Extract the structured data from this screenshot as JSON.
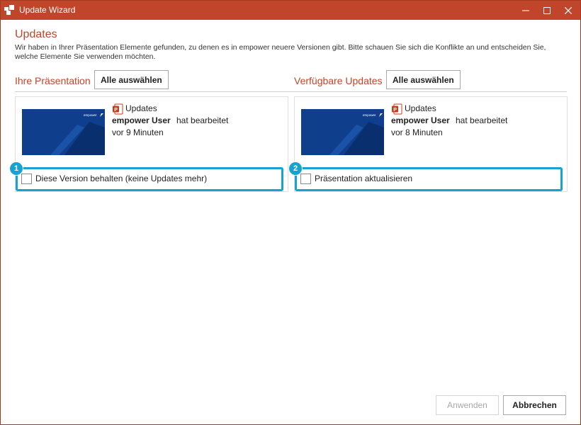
{
  "window": {
    "title": "Update Wizard"
  },
  "header": {
    "title": "Updates",
    "description": "Wir haben in Ihrer Präsentation Elemente gefunden, zu denen es in empower neuere Versionen gibt. Bitte schauen Sie sich die Konflikte an und entscheiden Sie, welche Elemente Sie verwenden möchten."
  },
  "left": {
    "label": "Ihre Präsentation",
    "select_all": "Alle auswählen",
    "card": {
      "doc_name": "Updates",
      "user": "empower User",
      "action": "hat bearbeitet",
      "time": "vor 9 Minuten",
      "thumb_brand": "empower",
      "option_badge": "1",
      "option_label": "Diese Version behalten (keine Updates mehr)",
      "option_checked": false
    }
  },
  "right": {
    "label": "Verfügbare Updates",
    "select_all": "Alle auswählen",
    "card": {
      "doc_name": "Updates",
      "user": "empower User",
      "action": "hat bearbeitet",
      "time": "vor 8 Minuten",
      "thumb_brand": "empower",
      "option_badge": "2",
      "option_label": "Präsentation aktualisieren",
      "option_checked": false
    }
  },
  "footer": {
    "apply": "Anwenden",
    "cancel": "Abbrechen"
  },
  "colors": {
    "accent": "#c0452b",
    "highlight": "#18a2d2",
    "thumb": "#0e3e8c"
  }
}
